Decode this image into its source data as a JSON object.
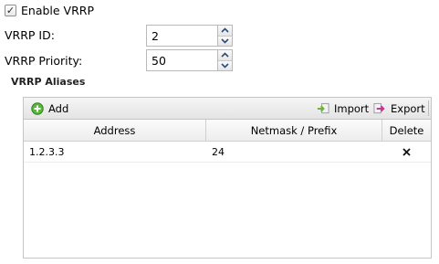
{
  "enable": {
    "label": "Enable VRRP",
    "checked": true
  },
  "vrrp_id": {
    "label": "VRRP ID:",
    "value": "2"
  },
  "vrrp_priority": {
    "label": "VRRP Priority:",
    "value": "50"
  },
  "aliases": {
    "title": "VRRP Aliases",
    "toolbar": {
      "add_label": "Add",
      "import_label": "Import",
      "export_label": "Export"
    },
    "columns": [
      "Address",
      "Netmask / Prefix",
      "Delete"
    ],
    "rows": [
      {
        "address": "1.2.3.3",
        "netmask": "24",
        "delete_icon": "✕"
      }
    ]
  },
  "colors": {
    "add_icon": "#3a9a2a",
    "import_icon": "#7ac142",
    "export_icon": "#c2389a"
  }
}
